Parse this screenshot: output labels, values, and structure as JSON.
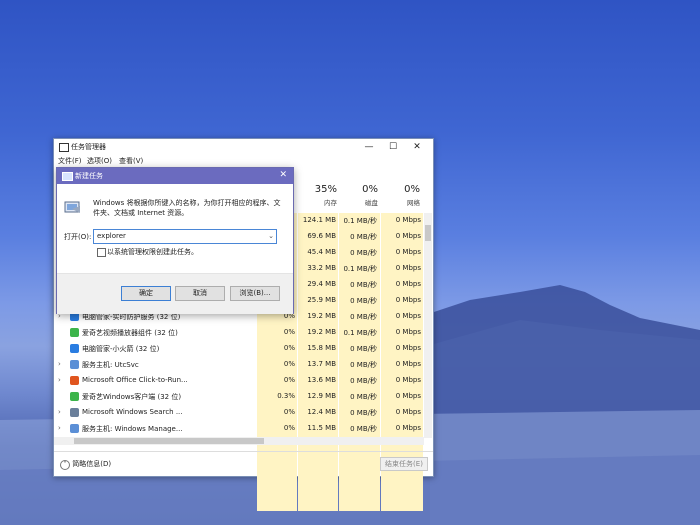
{
  "task_manager": {
    "title": "任务管理器",
    "window_buttons": [
      "—",
      "☐",
      "✕"
    ],
    "menu": [
      "文件(F)",
      "选项(O)",
      "查看(V)"
    ],
    "headers": [
      {
        "pct": "35%",
        "label": "内存"
      },
      {
        "pct": "0%",
        "label": "磁盘"
      },
      {
        "pct": "0%",
        "label": "网络"
      }
    ],
    "rows": [
      {
        "name": "",
        "cpu": "",
        "mem": "124.1 MB",
        "disk": "0.1 MB/秒",
        "net": "0 Mbps",
        "icon_color": "#ffffff",
        "chev": ""
      },
      {
        "name": "",
        "cpu": "",
        "mem": "69.6 MB",
        "disk": "0 MB/秒",
        "net": "0 Mbps",
        "icon_color": "#ffffff",
        "chev": ""
      },
      {
        "name": "",
        "cpu": "",
        "mem": "45.4 MB",
        "disk": "0 MB/秒",
        "net": "0 Mbps",
        "icon_color": "#ffffff",
        "chev": ""
      },
      {
        "name": "",
        "cpu": "",
        "mem": "33.2 MB",
        "disk": "0.1 MB/秒",
        "net": "0 Mbps",
        "icon_color": "#ffffff",
        "chev": ""
      },
      {
        "name": "",
        "cpu": "",
        "mem": "29.4 MB",
        "disk": "0 MB/秒",
        "net": "0 Mbps",
        "icon_color": "#ffffff",
        "chev": ""
      },
      {
        "name": "",
        "cpu": "",
        "mem": "25.9 MB",
        "disk": "0 MB/秒",
        "net": "0 Mbps",
        "icon_color": "#ffffff",
        "chev": ""
      },
      {
        "name": "电脑管家-实时防护服务 (32 位)",
        "cpu": "0%",
        "mem": "19.2 MB",
        "disk": "0 MB/秒",
        "net": "0 Mbps",
        "icon_color": "#2a7de1",
        "chev": "›"
      },
      {
        "name": "爱奇艺视频播放器组件 (32 位)",
        "cpu": "0%",
        "mem": "19.2 MB",
        "disk": "0.1 MB/秒",
        "net": "0 Mbps",
        "icon_color": "#3cb44a",
        "chev": ""
      },
      {
        "name": "电脑管家-小火箭 (32 位)",
        "cpu": "0%",
        "mem": "15.8 MB",
        "disk": "0 MB/秒",
        "net": "0 Mbps",
        "icon_color": "#2a7de1",
        "chev": ""
      },
      {
        "name": "服务主机: UtcSvc",
        "cpu": "0%",
        "mem": "13.7 MB",
        "disk": "0 MB/秒",
        "net": "0 Mbps",
        "icon_color": "#5b8fd6",
        "chev": "›"
      },
      {
        "name": "Microsoft Office Click-to-Run...",
        "cpu": "0%",
        "mem": "13.6 MB",
        "disk": "0 MB/秒",
        "net": "0 Mbps",
        "icon_color": "#e0551f",
        "chev": "›"
      },
      {
        "name": "爱奇艺Windows客户端 (32 位)",
        "cpu": "0.3%",
        "mem": "12.9 MB",
        "disk": "0 MB/秒",
        "net": "0 Mbps",
        "icon_color": "#3cb44a",
        "chev": ""
      },
      {
        "name": "Microsoft Windows Search ...",
        "cpu": "0%",
        "mem": "12.4 MB",
        "disk": "0 MB/秒",
        "net": "0 Mbps",
        "icon_color": "#6a7f9a",
        "chev": "›"
      },
      {
        "name": "服务主机: Windows Manage...",
        "cpu": "0%",
        "mem": "11.5 MB",
        "disk": "0 MB/秒",
        "net": "0 Mbps",
        "icon_color": "#5b8fd6",
        "chev": "›"
      }
    ],
    "fewer_details": "简略信息(D)",
    "end_task": "结束任务(E)",
    "highlight_color": "#fff4c4"
  },
  "run_dialog": {
    "title": "新建任务",
    "close": "✕",
    "description": "Windows 将根据你所键入的名称，为你打开相应的程序、文件夹、文档或 Internet 资源。",
    "open_label": "打开(O):",
    "open_value": "explorer",
    "admin_checkbox_label": "以系统管理权限创建此任务。",
    "ok": "确定",
    "cancel": "取消",
    "browse": "浏览(B)...",
    "title_bar_color": "#6b6bbf"
  }
}
